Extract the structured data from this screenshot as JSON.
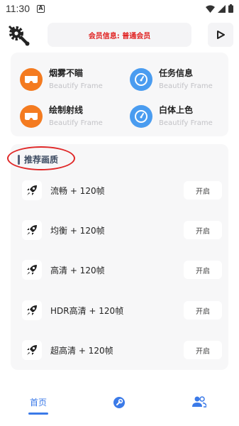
{
  "status_bar": {
    "time": "11:30",
    "notification_badge": "A"
  },
  "header": {
    "member_text": "会员信息: 普通会员",
    "settings_icon": "gear-wrench-icon",
    "play_icon": "play-icon"
  },
  "features": [
    {
      "title": "烟雾不瞄",
      "subtitle": "Beautify Frame",
      "icon": "vr-goggles-icon",
      "color": "#f47b20"
    },
    {
      "title": "任务信息",
      "subtitle": "Beautify Frame",
      "icon": "speedometer-icon",
      "color": "#4a9cf0"
    },
    {
      "title": "绘制射线",
      "subtitle": "Beautify Frame",
      "icon": "vr-goggles-icon",
      "color": "#f47b20"
    },
    {
      "title": "白体上色",
      "subtitle": "Beautify Frame",
      "icon": "speedometer-icon",
      "color": "#4a9cf0"
    }
  ],
  "quality_section": {
    "title": "推荐画质",
    "items": [
      {
        "label": "流畅 + 120帧",
        "button": "开启"
      },
      {
        "label": "均衡 + 120帧",
        "button": "开启"
      },
      {
        "label": "高清 + 120帧",
        "button": "开启"
      },
      {
        "label": "HDR高清 + 120帧",
        "button": "开启"
      },
      {
        "label": "超高清 + 120帧",
        "button": "开启"
      }
    ]
  },
  "bottom_nav": {
    "home_label": "首页",
    "tools_icon": "wrench-circle-icon",
    "users_icon": "users-icon"
  },
  "colors": {
    "accent": "#3b7ae8",
    "member_text": "#e02020",
    "highlight": "#e02828"
  }
}
